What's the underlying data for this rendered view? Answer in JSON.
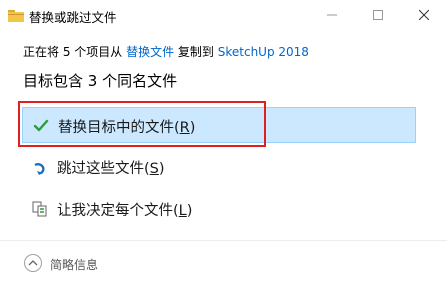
{
  "window": {
    "title": "替换或跳过文件",
    "minimize_icon": "minimize-icon",
    "maximize_icon": "maximize-icon",
    "close_icon": "close-icon"
  },
  "copy_info": {
    "prefix": "正在将 5 个项目从 ",
    "source": "替换文件",
    "middle": " 复制到 ",
    "destination": "SketchUp 2018"
  },
  "heading": "目标包含 3 个同名文件",
  "options": [
    {
      "label": "替换目标中的文件(",
      "key": "R",
      "suffix": ")",
      "icon": "checkmark-icon",
      "selected": true
    },
    {
      "label": "跳过这些文件(",
      "key": "S",
      "suffix": ")",
      "icon": "skip-arrow-icon"
    },
    {
      "label": "让我决定每个文件(",
      "key": "L",
      "suffix": ")",
      "icon": "compare-files-icon"
    }
  ],
  "footer": {
    "details_label": "简略信息",
    "details_icon": "chevron-up-icon"
  },
  "colors": {
    "selected_bg": "#cce8ff",
    "link": "#0066cc",
    "highlight_border": "#e02020",
    "check": "#2e9b3e"
  }
}
